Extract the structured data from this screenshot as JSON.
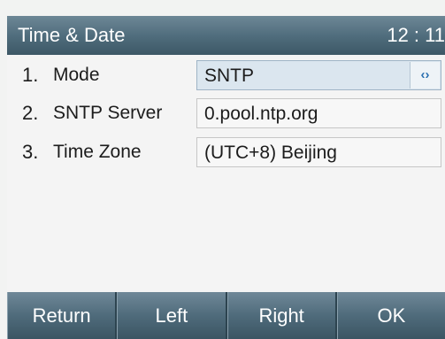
{
  "title_bar": {
    "title": "Time & Date",
    "clock": "12 : 11"
  },
  "settings": [
    {
      "index": "1.",
      "label": "Mode",
      "value": "SNTP",
      "control": "selector",
      "selected": true
    },
    {
      "index": "2.",
      "label": "SNTP Server",
      "value": "0.pool.ntp.org",
      "control": "text"
    },
    {
      "index": "3.",
      "label": "Time Zone",
      "value": "(UTC+8) Beijing",
      "control": "text"
    }
  ],
  "selector_icon": "left-right-arrows-icon",
  "softkeys": {
    "return": "Return",
    "left": "Left",
    "right": "Right",
    "ok": "OK"
  },
  "colors": {
    "bar_accent": "#4e6b7b",
    "selected_field": "#dbe6ef",
    "arrow": "#2a6fb0"
  }
}
